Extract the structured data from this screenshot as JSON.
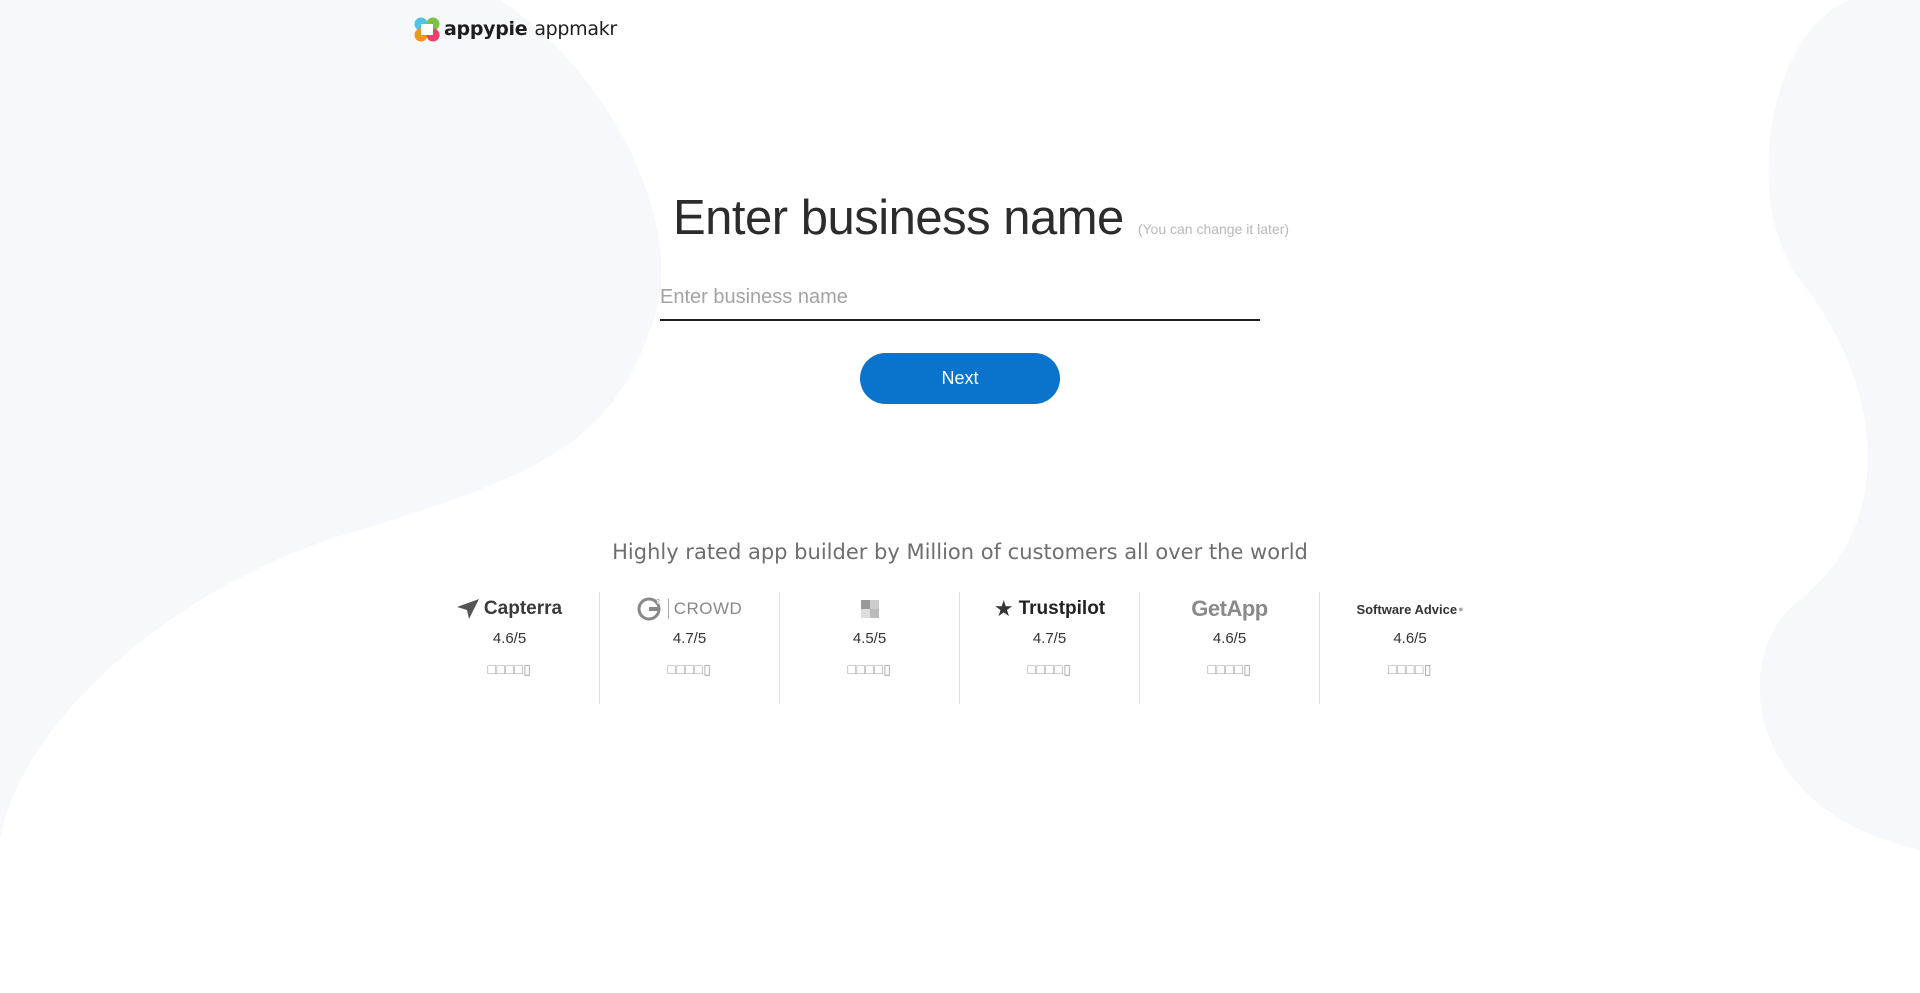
{
  "brand": {
    "logo_name": "appypie",
    "product_name": "appmakr"
  },
  "form": {
    "title": "Enter business name",
    "hint": "(You can change it later)",
    "input_placeholder": "Enter business name",
    "input_value": "",
    "next_label": "Next"
  },
  "ratings_section": {
    "tagline": "Highly rated app builder by Million of customers all over the world",
    "stars_glyph": "□□□□▯",
    "items": [
      {
        "brand": "Capterra",
        "score": "4.6/5"
      },
      {
        "brand": "CROWD",
        "score": "4.7/5"
      },
      {
        "brand": "",
        "score": "4.5/5"
      },
      {
        "brand": "Trustpilot",
        "score": "4.7/5"
      },
      {
        "brand": "GetApp",
        "score": "4.6/5"
      },
      {
        "brand": "Software Advice",
        "score": "4.6/5"
      }
    ]
  },
  "colors": {
    "accent": "#0a73cc",
    "background_blob": "#f7f8fc"
  }
}
